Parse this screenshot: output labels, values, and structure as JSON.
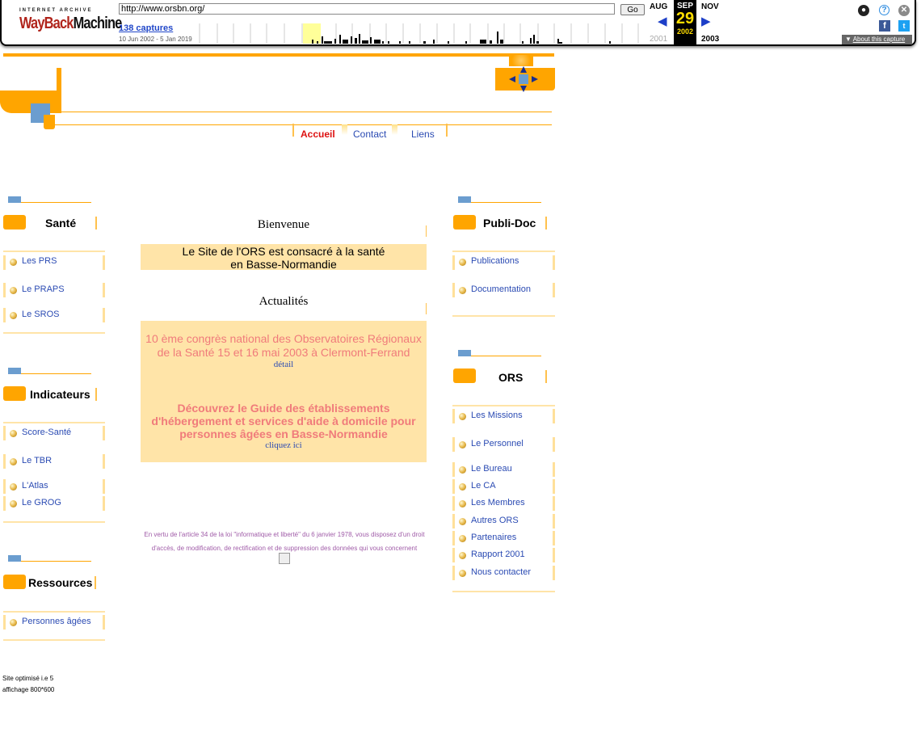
{
  "wayback": {
    "logo_top": "INTERNET ARCHIVE",
    "logo_a": "WayBack",
    "logo_b": "Machine",
    "url": "http://www.orsbn.org/",
    "go_label": "Go",
    "captures": "138 captures",
    "range": "10 Jun 2002 - 5 Jan 2019",
    "prev_month": "AUG",
    "cur_month": "SEP",
    "next_month": "NOV",
    "day": "29",
    "prev_year": "2001",
    "cur_year": "2002",
    "next_year": "2003",
    "about": "About this capture",
    "colors": {
      "accent": "#b0241b",
      "link": "#2147c9",
      "highlight": "#ffde00"
    }
  },
  "nav": {
    "accueil": "Accueil",
    "contact": "Contact",
    "liens": "Liens"
  },
  "left": {
    "sante": {
      "title": "Santé",
      "items": [
        "Les PRS",
        "Le PRAPS",
        "Le SROS"
      ]
    },
    "indicateurs": {
      "title": "Indicateurs",
      "items": [
        "Score-Santé",
        "Le TBR",
        "L'Atlas",
        "Le GROG"
      ]
    },
    "ressources": {
      "title": "Ressources",
      "items": [
        "Personnes âgées"
      ]
    }
  },
  "right": {
    "publidoc": {
      "title": "Publi-Doc",
      "items": [
        "Publications",
        "Documentation"
      ]
    },
    "ors": {
      "title": "ORS",
      "items": [
        "Les Missions",
        "Le Personnel",
        "Le Bureau",
        "Le CA",
        "Les Membres",
        "Autres ORS",
        "Partenaires",
        "Rapport 2001",
        "Nous contacter"
      ]
    }
  },
  "center": {
    "bienvenue": "Bienvenue",
    "intro1": "Le Site de l'ORS est consacré à la santé",
    "intro2": "en Basse-Normandie",
    "actualites": "Actualités",
    "news1a": "10 ème congrès national des Observatoires Régionaux",
    "news1b": "de la Santé 15 et 16 mai 2003 à Clermont-Ferrand",
    "detail": "détail",
    "news2a": "Découvrez le Guide des établissements",
    "news2b": "d'hébergement et services d'aide à domicile pour",
    "news2c": "personnes âgées en Basse-Normandie",
    "cliquez": "cliquez ici",
    "legal1": "En vertu de l'article 34 de la loi \"informatique et liberté\" du 6 janvier 1978, vous disposez d'un droit",
    "legal2": "d'accès, de modification, de rectification et de suppression des données qui vous concernent"
  },
  "footer": {
    "line1": "Site optimisé i.e 5",
    "line2": "affichage 800*600"
  }
}
